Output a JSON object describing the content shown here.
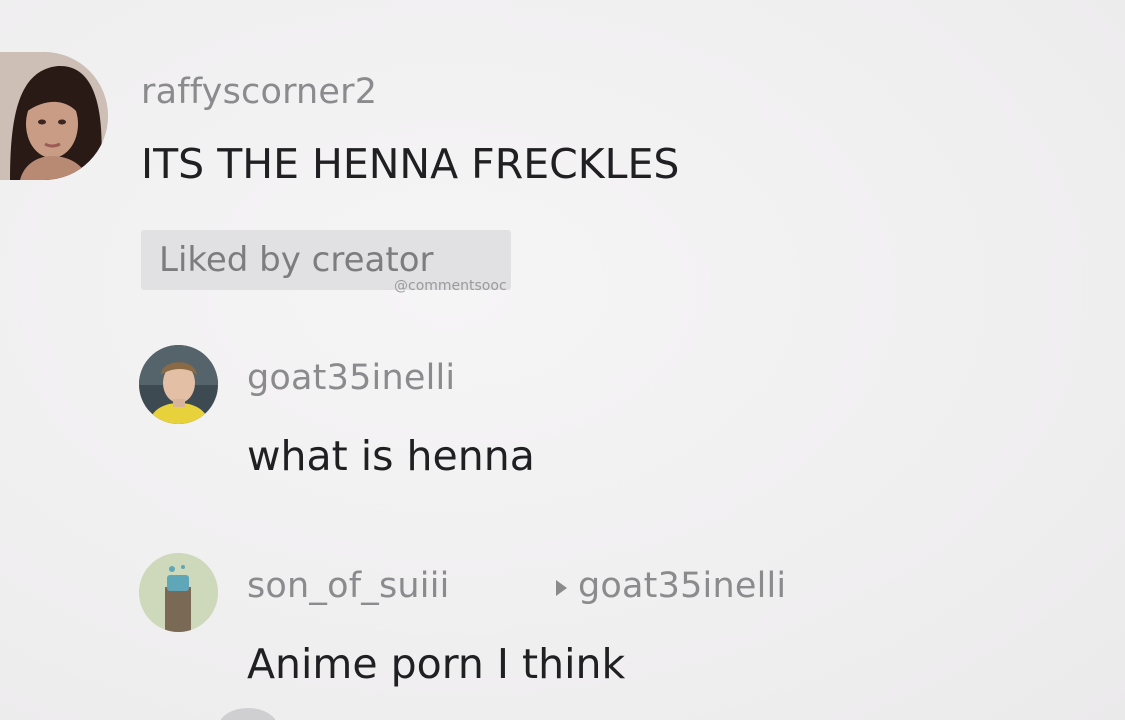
{
  "comments": [
    {
      "username": "raffyscorner2",
      "text": "ITS THE HENNA FRECKLES",
      "badge": "Liked by creator",
      "avatar_icon": "woman-portrait-avatar"
    },
    {
      "username": "goat35inelli",
      "text": "what is henna",
      "avatar_icon": "man-portrait-avatar"
    },
    {
      "username": "son_of_suiii",
      "reply_to": "goat35inelli",
      "text": "Anime porn I think",
      "avatar_icon": "cartoon-figure-avatar"
    }
  ],
  "watermark": "@commentsooc",
  "colors": {
    "background": "#f2f1f2",
    "username": "#8b8b8e",
    "text": "#202023",
    "badge_bg": "#e1e0e2"
  }
}
